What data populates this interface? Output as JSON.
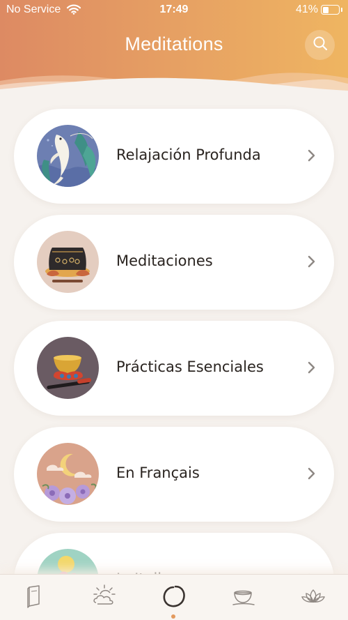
{
  "status_bar": {
    "carrier": "No Service",
    "time": "17:49",
    "battery_percent": "41%",
    "battery_level": 0.41
  },
  "header": {
    "title": "Meditations",
    "search_icon": "search-icon"
  },
  "categories": [
    {
      "label": "Relajación Profunda",
      "art": "koi-fish-illustration"
    },
    {
      "label": "Meditaciones",
      "art": "ornate-cushion-illustration"
    },
    {
      "label": "Prácticas Esenciales",
      "art": "singing-bowl-illustration"
    },
    {
      "label": "En Français",
      "art": "moon-and-flowers-illustration"
    },
    {
      "label": "In Italiano",
      "art": "sun-and-lotus-illustration"
    }
  ],
  "tab_bar": {
    "tabs": [
      {
        "icon": "book-icon"
      },
      {
        "icon": "sun-behind-cloud-icon"
      },
      {
        "icon": "enso-circle-icon",
        "active": true
      },
      {
        "icon": "tea-cup-icon"
      },
      {
        "icon": "lotus-icon"
      }
    ]
  },
  "colors": {
    "header_start": "#dd8a63",
    "header_end": "#efb561",
    "background": "#f6f2ee",
    "active_dot": "#e39a5e"
  }
}
